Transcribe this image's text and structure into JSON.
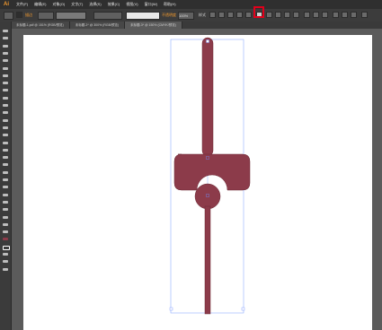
{
  "app": {
    "logo": "Ai"
  },
  "menu": [
    "文件(F)",
    "编辑(E)",
    "对象(O)",
    "文字(T)",
    "选择(S)",
    "效果(C)",
    "视图(V)",
    "窗口(W)",
    "帮助(H)"
  ],
  "controlbar": {
    "fill_label": "描边",
    "opacity_label": "不透明度",
    "style_label": "样式",
    "opacity_value": "100%",
    "stroke_profile": "等比"
  },
  "tabs": [
    {
      "label": "未标题-1.pdf @ 151% (RGB/预览)",
      "active": false
    },
    {
      "label": "未标题-2* @ 300% (RGB/预览)",
      "active": false
    },
    {
      "label": "未标题-3* @ 150% (CMYK/预览)",
      "active": true
    }
  ],
  "colors": {
    "shape_fill": "#8c3b4a",
    "shape_stroke": "#6c2a36",
    "bbox_stroke": "#8fb0ff",
    "highlight": "#e1001b",
    "logo": "#f39a2e"
  },
  "icons": {
    "tools": [
      "selection-tool-icon",
      "direct-selection-tool-icon",
      "magic-wand-icon",
      "lasso-icon",
      "pen-tool-icon",
      "type-tool-icon",
      "line-tool-icon",
      "rectangle-tool-icon",
      "paintbrush-icon",
      "pencil-icon",
      "blob-brush-icon",
      "eraser-icon",
      "rotate-tool-icon",
      "scale-tool-icon",
      "width-tool-icon",
      "free-transform-icon",
      "shape-builder-icon",
      "perspective-grid-icon",
      "mesh-tool-icon",
      "gradient-tool-icon",
      "eyedropper-icon",
      "blend-tool-icon",
      "symbol-sprayer-icon",
      "column-graph-icon",
      "artboard-tool-icon",
      "slice-tool-icon",
      "hand-tool-icon",
      "zoom-tool-icon",
      "fill-swatch-icon",
      "stroke-swatch-icon",
      "swap-fill-stroke-icon",
      "drawing-mode-icon",
      "screen-mode-icon"
    ]
  }
}
